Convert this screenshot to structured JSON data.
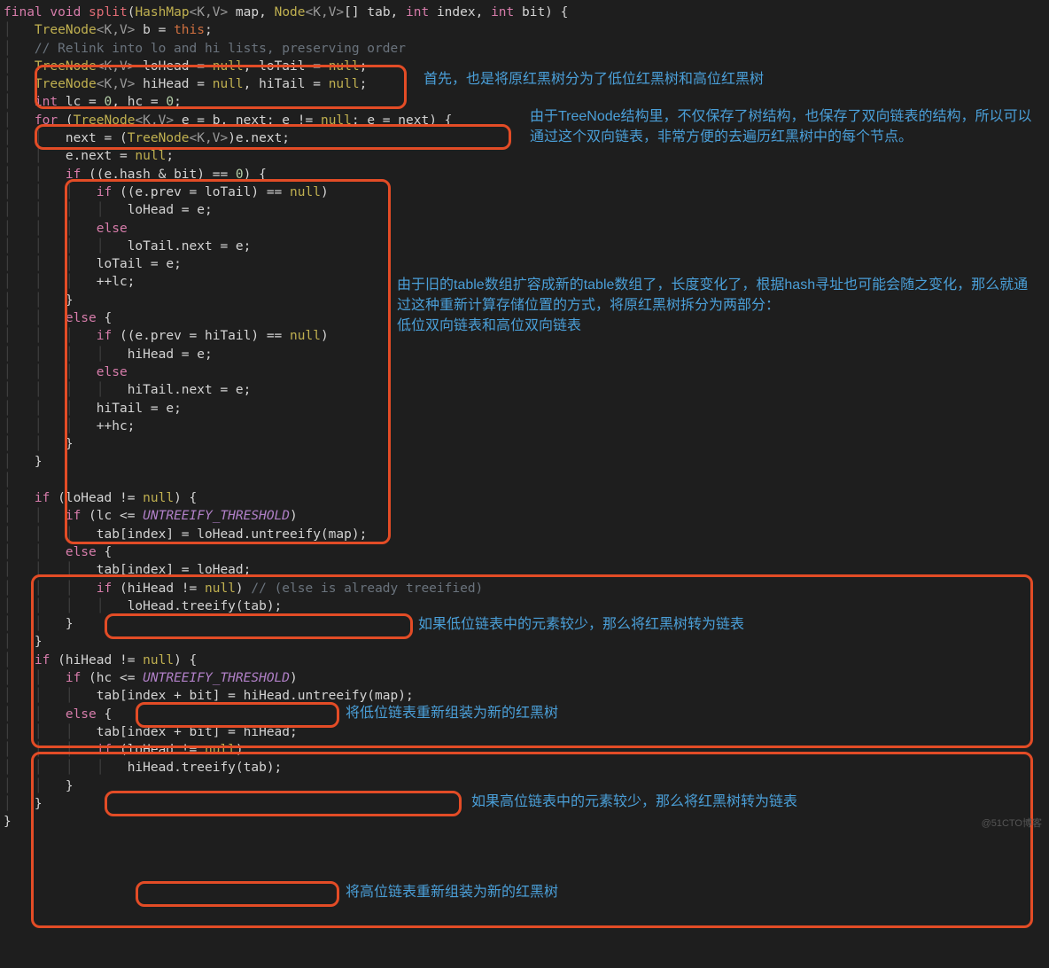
{
  "code": {
    "l1": {
      "kw1": "final",
      "kw2": "void",
      "fn": "split",
      "sig1": "(",
      "t1": "HashMap",
      "g1": "<K,V>",
      "p1": " map, ",
      "t2": "Node",
      "g2": "<K,V>",
      "p2": "[] tab, ",
      "kw3": "int",
      "p3": " index, ",
      "kw4": "int",
      "p4": " bit) {"
    },
    "l2": {
      "t": "TreeNode",
      "g": "<K,V>",
      "txt": " b = ",
      "this": "this",
      "end": ";"
    },
    "l3": {
      "cmt": "// Relink into lo and hi lists, preserving order"
    },
    "l4": {
      "t": "TreeNode",
      "g": "<K,V>",
      "txt": " loHead = ",
      "n1": "null",
      "c": ", loTail = ",
      "n2": "null",
      "end": ";"
    },
    "l5": {
      "t": "TreeNode",
      "g": "<K,V>",
      "txt": " hiHead = ",
      "n1": "null",
      "c": ", hiTail = ",
      "n2": "null",
      "end": ";"
    },
    "l6": {
      "kw": "int",
      "txt": " lc = ",
      "z1": "0",
      "c": ", hc = ",
      "z2": "0",
      "end": ";"
    },
    "l7": {
      "kw": "for",
      "p1": " (",
      "t": "TreeNode",
      "g": "<K,V>",
      "p2": " e = b, next; e != ",
      "n": "null",
      "p3": "; e = next) {"
    },
    "l8": {
      "txt": "next = (",
      "t": "TreeNode",
      "g": "<K,V>",
      "end": ")e.next;"
    },
    "l9": {
      "txt": "e.next = ",
      "n": "null",
      "end": ";"
    },
    "l10": {
      "kw": "if",
      "txt": " ((e.hash & bit) == ",
      "z": "0",
      "end": ") {"
    },
    "l11": {
      "kw": "if",
      "txt": " ((e.prev = loTail) == ",
      "n": "null",
      "end": ")"
    },
    "l12": {
      "txt": "loHead = e;"
    },
    "l13": {
      "kw": "else"
    },
    "l14": {
      "txt": "loTail.next = e;"
    },
    "l15": {
      "txt": "loTail = e;"
    },
    "l16": {
      "txt": "++lc;"
    },
    "l17": {
      "txt": "}"
    },
    "l18": {
      "kw": "else",
      "txt": " {"
    },
    "l19": {
      "kw": "if",
      "txt": " ((e.prev = hiTail) == ",
      "n": "null",
      "end": ")"
    },
    "l20": {
      "txt": "hiHead = e;"
    },
    "l21": {
      "kw": "else"
    },
    "l22": {
      "txt": "hiTail.next = e;"
    },
    "l23": {
      "txt": "hiTail = e;"
    },
    "l24": {
      "txt": "++hc;"
    },
    "l25": {
      "txt": "}"
    },
    "l26": {
      "txt": "}"
    },
    "l27": {
      "kw": "if",
      "txt": " (loHead != ",
      "n": "null",
      "end": ") {"
    },
    "l28": {
      "kw": "if",
      "txt": " (lc <= ",
      "c": "UNTREEIFY_THRESHOLD",
      "end": ")"
    },
    "l29": {
      "txt": "tab[index] = loHead.untreeify(map);"
    },
    "l30": {
      "kw": "else",
      "txt": " {"
    },
    "l31": {
      "txt": "tab[index] = loHead;"
    },
    "l32": {
      "kw": "if",
      "txt": " (hiHead != ",
      "n": "null",
      "end": ") ",
      "cmt": "// (else is already treeified)"
    },
    "l33": {
      "txt": "loHead.treeify(tab);"
    },
    "l34": {
      "txt": "}"
    },
    "l35": {
      "txt": "}"
    },
    "l36": {
      "kw": "if",
      "txt": " (hiHead != ",
      "n": "null",
      "end": ") {"
    },
    "l37": {
      "kw": "if",
      "txt": " (hc <= ",
      "c": "UNTREEIFY_THRESHOLD",
      "end": ")"
    },
    "l38": {
      "txt": "tab[index + bit] = hiHead.untreeify(map);"
    },
    "l39": {
      "kw": "else",
      "txt": " {"
    },
    "l40": {
      "txt": "tab[index + bit] = hiHead;"
    },
    "l41": {
      "kw": "if",
      "txt": " (loHead != ",
      "n": "null",
      "end": ")"
    },
    "l42": {
      "txt": "hiHead.treeify(tab);"
    },
    "l43": {
      "txt": "}"
    },
    "l44": {
      "txt": "}"
    },
    "l45": {
      "txt": "}"
    }
  },
  "anno": {
    "a1": "首先，也是将原红黑树分为了低位红黑树和高位红黑树",
    "a2": "由于TreeNode结构里，不仅保存了树结构，也保存了双向链表的结构，所以可以通过这个双向链表，非常方便的去遍历红黑树中的每个节点。",
    "a3": "由于旧的table数组扩容成新的table数组了，长度变化了，根据hash寻址也可能会随之变化，那么就通过这种重新计算存储位置的方式，将原红黑树拆分为两部分：\n低位双向链表和高位双向链表",
    "a4": "如果低位链表中的元素较少，那么将红黑树转为链表",
    "a5": "将低位链表重新组装为新的红黑树",
    "a6": "如果高位链表中的元素较少，那么将红黑树转为链表",
    "a7": "将高位链表重新组装为新的红黑树"
  },
  "watermark": "@51CTO博客"
}
